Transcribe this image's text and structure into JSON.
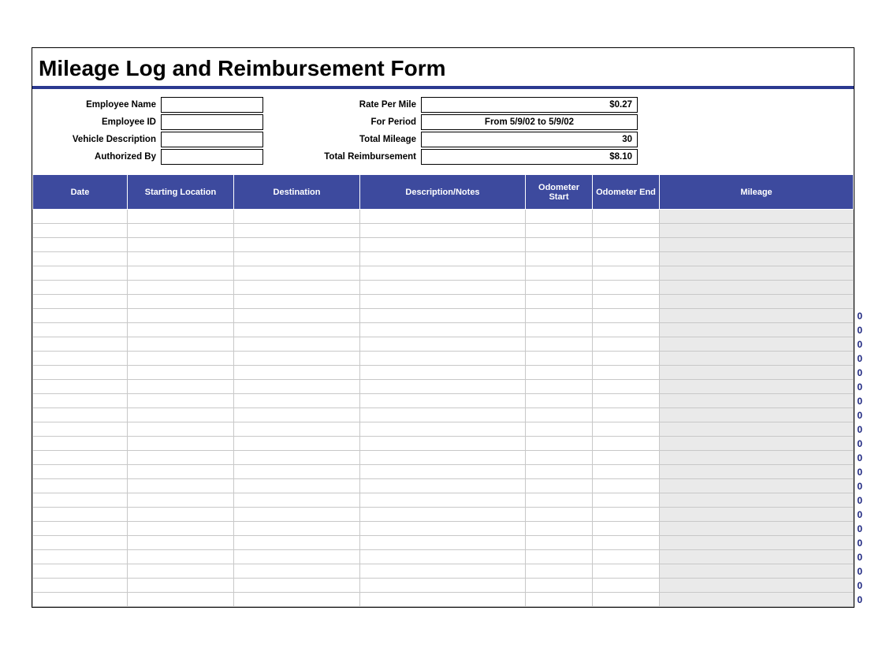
{
  "title": "Mileage Log and Reimbursement Form",
  "info_left": {
    "employee_name": {
      "label": "Employee Name",
      "value": ""
    },
    "employee_id": {
      "label": "Employee ID",
      "value": ""
    },
    "vehicle_description": {
      "label": "Vehicle Description",
      "value": ""
    },
    "authorized_by": {
      "label": "Authorized By",
      "value": ""
    }
  },
  "info_right": {
    "rate_per_mile": {
      "label": "Rate Per Mile",
      "value": "$0.27"
    },
    "for_period": {
      "label": "For Period",
      "value": "From 5/9/02 to 5/9/02"
    },
    "total_mileage": {
      "label": "Total Mileage",
      "value": "30"
    },
    "total_reimbursement": {
      "label": "Total Reimbursement",
      "value": "$8.10"
    }
  },
  "columns": [
    "Date",
    "Starting Location",
    "Destination",
    "Description/Notes",
    "Odometer Start",
    "Odometer End",
    "Mileage"
  ],
  "rows": [
    {
      "mileage": ""
    },
    {
      "mileage": ""
    },
    {
      "mileage": ""
    },
    {
      "mileage": ""
    },
    {
      "mileage": ""
    },
    {
      "mileage": ""
    },
    {
      "mileage": ""
    },
    {
      "mileage": "0"
    },
    {
      "mileage": "0"
    },
    {
      "mileage": "0"
    },
    {
      "mileage": "0"
    },
    {
      "mileage": "0"
    },
    {
      "mileage": "0"
    },
    {
      "mileage": "0"
    },
    {
      "mileage": "0"
    },
    {
      "mileage": "0"
    },
    {
      "mileage": "0"
    },
    {
      "mileage": "0"
    },
    {
      "mileage": "0"
    },
    {
      "mileage": "0"
    },
    {
      "mileage": "0"
    },
    {
      "mileage": "0"
    },
    {
      "mileage": "0"
    },
    {
      "mileage": "0"
    },
    {
      "mileage": "0"
    },
    {
      "mileage": "0"
    },
    {
      "mileage": "0"
    },
    {
      "mileage": "0"
    }
  ]
}
